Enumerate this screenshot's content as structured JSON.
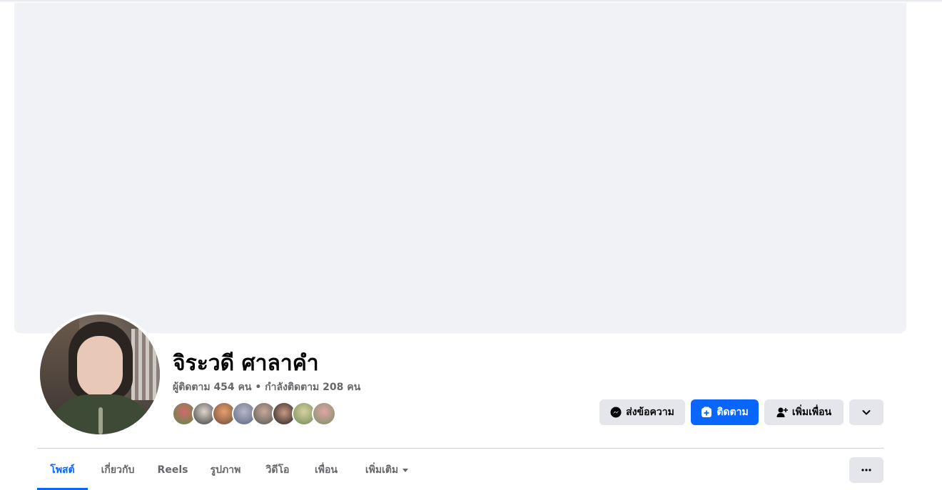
{
  "profile": {
    "name": "จิระวดี ศาลาคำ",
    "stats": "ผู้ติดตาม 454 คน • กำลังติดตาม 208 คน"
  },
  "actions": {
    "message_label": "ส่งข้อความ",
    "follow_label": "ติดตาม",
    "add_friend_label": "เพิ่มเพื่อน"
  },
  "tabs": [
    {
      "label": "โพสต์",
      "active": true
    },
    {
      "label": "เกี่ยวกับ"
    },
    {
      "label": "Reels"
    },
    {
      "label": "รูปภาพ"
    },
    {
      "label": "วิดีโอ"
    },
    {
      "label": "เพื่อน"
    },
    {
      "label": "เพิ่มเติม"
    }
  ],
  "colors": {
    "accent": "#0866ff",
    "cover": "#f0f2f5",
    "button_secondary": "#e4e6eb",
    "muted_text": "#65676b"
  },
  "icons": {
    "message": "messenger-icon",
    "follow": "follow-plus-icon",
    "add_friend": "add-friend-icon",
    "dropdown": "chevron-down-icon",
    "more": "more-dots-icon"
  }
}
